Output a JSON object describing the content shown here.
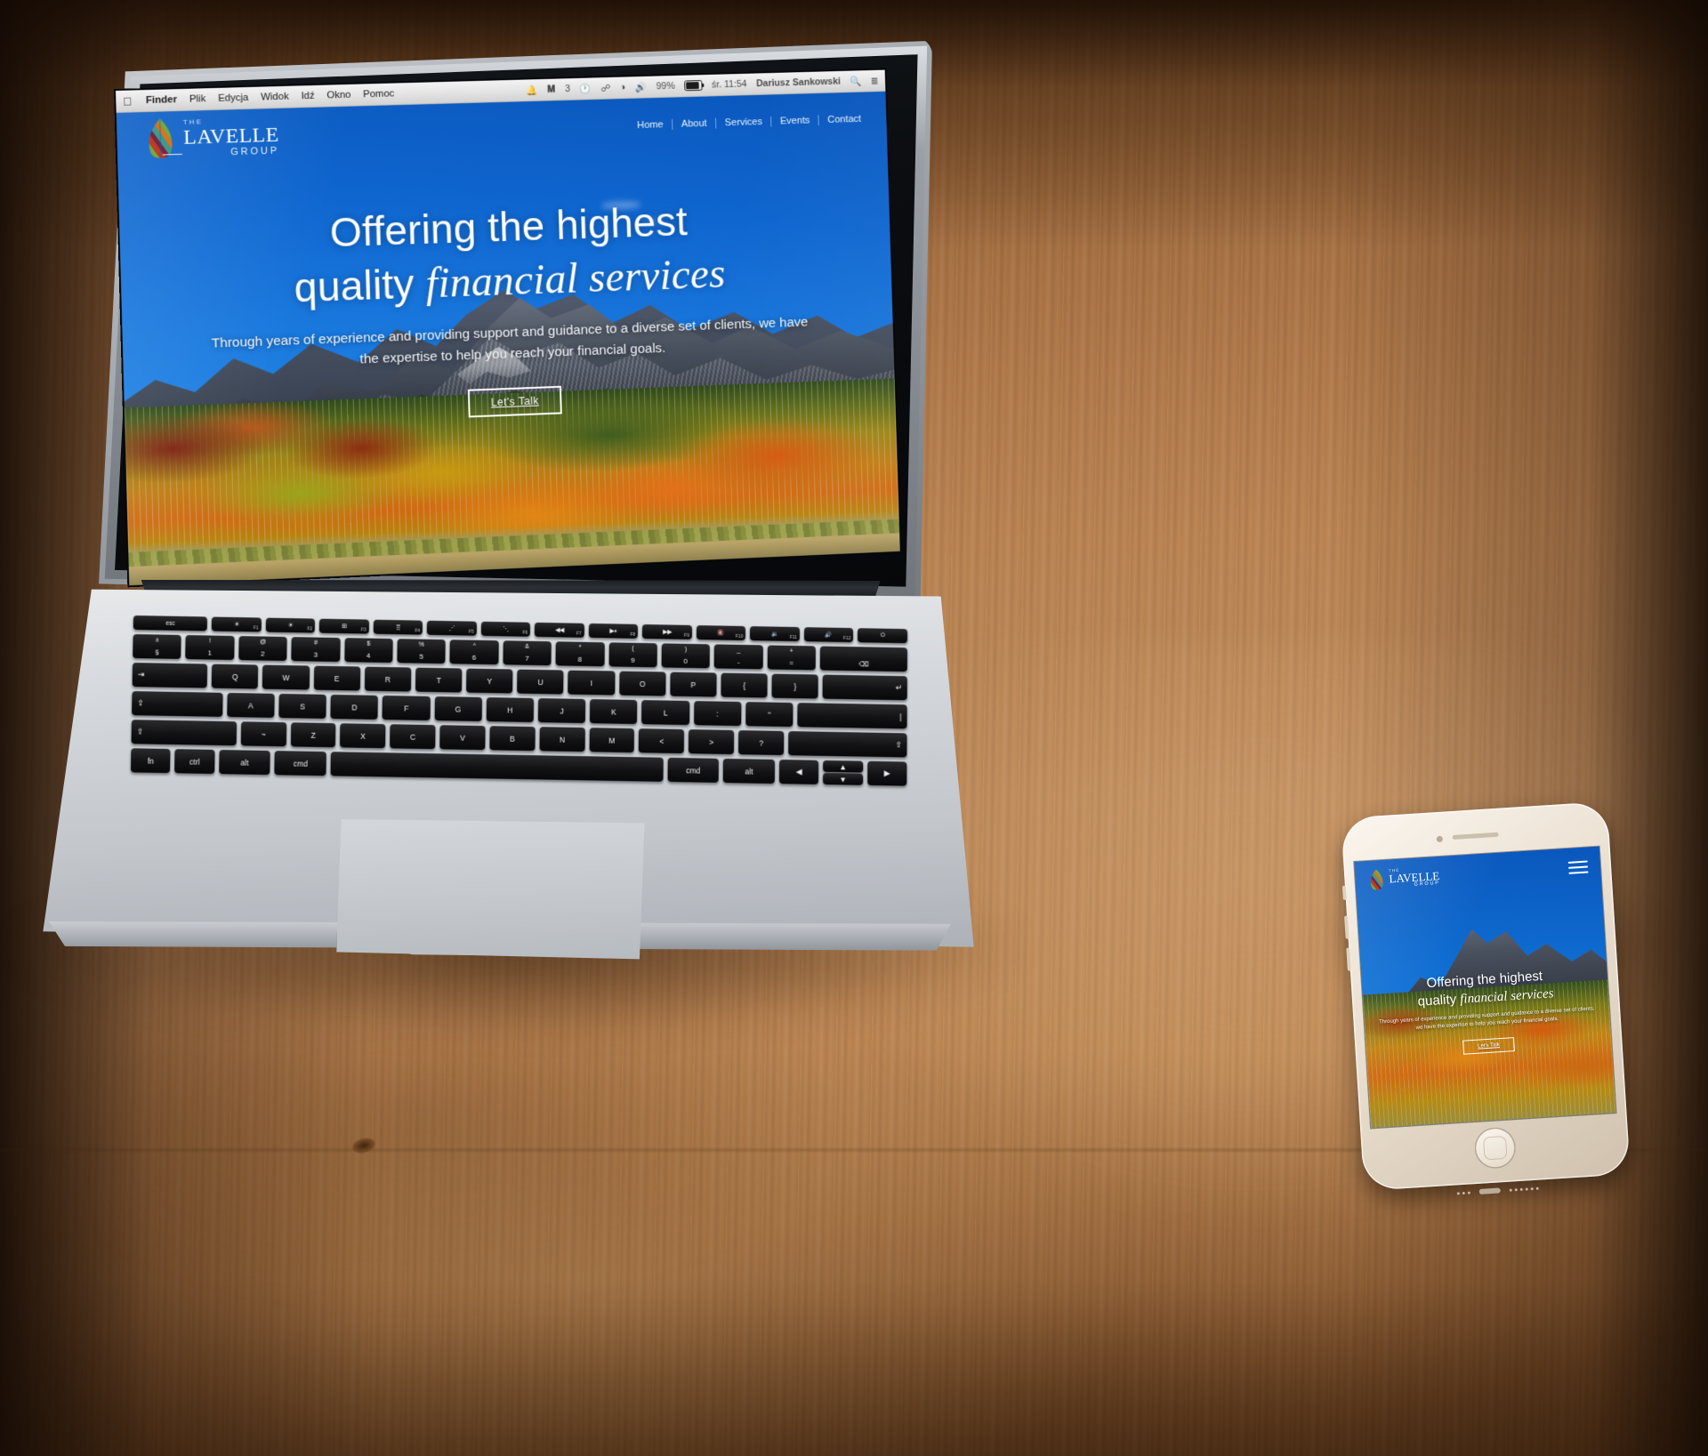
{
  "os": {
    "menubar": {
      "apple_icon": "apple-icon",
      "items": [
        {
          "label": "Finder",
          "bold": true
        },
        {
          "label": "Plik",
          "bold": false
        },
        {
          "label": "Edycja",
          "bold": false
        },
        {
          "label": "Widok",
          "bold": false
        },
        {
          "label": "Idź",
          "bold": false
        },
        {
          "label": "Okno",
          "bold": false
        },
        {
          "label": "Pomoc",
          "bold": false
        }
      ],
      "status": {
        "bell_icon": "bell-icon",
        "alfred_icon": "alfred-icon",
        "alfred_count": "3",
        "timemachine_icon": "time-machine-icon",
        "bluetooth_icon": "bluetooth-icon",
        "wifi_icon": "wifi-icon",
        "volume_icon": "volume-icon",
        "battery_percent": "99%",
        "battery_icon": "battery-charging-icon",
        "clock": "śr. 11:54",
        "user": "Dariusz Sankowski",
        "search_icon": "spotlight-search-icon",
        "notification_center_icon": "notification-center-icon"
      }
    }
  },
  "site": {
    "logo": {
      "icon": "leaf-logo-icon",
      "the": "THE",
      "name": "LAVELLE",
      "group": "GROUP"
    },
    "nav": [
      {
        "label": "Home"
      },
      {
        "label": "About"
      },
      {
        "label": "Services"
      },
      {
        "label": "Events"
      },
      {
        "label": "Contact"
      }
    ],
    "hero": {
      "line1": "Offering the highest",
      "line2_plain": "quality ",
      "line2_italic": "financial services",
      "subtitle": "Through years of experience and providing support and guidance to a diverse set of clients, we have the expertise to help you reach your financial goals.",
      "cta": "Let's Talk"
    },
    "colors": {
      "sky_blue": "#0f66cf",
      "accent_white": "#ffffff",
      "leaf_teal": "#3f9b8e",
      "leaf_green": "#7aa83f",
      "leaf_orange": "#e2701d",
      "leaf_red": "#c23b22",
      "leaf_maroon": "#7b2440"
    }
  },
  "phone": {
    "menu_icon": "hamburger-menu-icon",
    "home_button": "home-button",
    "lightning_port": "lightning-port-icon",
    "speaker_grille": "speaker-grille-icon"
  },
  "keyboard": {
    "fn_row": [
      {
        "label": "esc",
        "sub": ""
      },
      {
        "label": "☀",
        "sub": "F1"
      },
      {
        "label": "☀",
        "sub": "F2"
      },
      {
        "label": "⊞",
        "sub": "F3"
      },
      {
        "label": "⣿",
        "sub": "F4"
      },
      {
        "label": "⋰",
        "sub": "F5"
      },
      {
        "label": "⋱",
        "sub": "F6"
      },
      {
        "label": "◀◀",
        "sub": "F7"
      },
      {
        "label": "▶⏸",
        "sub": "F8"
      },
      {
        "label": "▶▶",
        "sub": "F9"
      },
      {
        "label": "🔇",
        "sub": "F10"
      },
      {
        "label": "🔉",
        "sub": "F11"
      },
      {
        "label": "🔊",
        "sub": "F12"
      },
      {
        "label": "⏻",
        "sub": ""
      }
    ],
    "row_num": [
      {
        "up": "±",
        "dn": "§"
      },
      {
        "up": "!",
        "dn": "1"
      },
      {
        "up": "@",
        "dn": "2"
      },
      {
        "up": "#",
        "dn": "3"
      },
      {
        "up": "$",
        "dn": "4"
      },
      {
        "up": "%",
        "dn": "5"
      },
      {
        "up": "^",
        "dn": "6"
      },
      {
        "up": "&",
        "dn": "7"
      },
      {
        "up": "*",
        "dn": "8"
      },
      {
        "up": "(",
        "dn": "9"
      },
      {
        "up": ")",
        "dn": "0"
      },
      {
        "up": "_",
        "dn": "-"
      },
      {
        "up": "+",
        "dn": "="
      },
      {
        "up": "",
        "dn": "⌫"
      }
    ],
    "row_q": [
      "⇥",
      "Q",
      "W",
      "E",
      "R",
      "T",
      "Y",
      "U",
      "I",
      "O",
      "P",
      "{",
      "}",
      "↵"
    ],
    "row_a": [
      "⇪",
      "A",
      "S",
      "D",
      "F",
      "G",
      "H",
      "J",
      "K",
      "L",
      ":",
      "\"",
      "|"
    ],
    "row_z": [
      "⇧",
      "~",
      "Z",
      "X",
      "C",
      "V",
      "B",
      "N",
      "M",
      "<",
      ">",
      "?",
      "⇧"
    ],
    "row_mod": [
      {
        "label": "fn"
      },
      {
        "label": "ctrl"
      },
      {
        "label": "alt"
      },
      {
        "label": "cmd"
      },
      {
        "label": ""
      },
      {
        "label": "cmd"
      },
      {
        "label": "alt"
      }
    ]
  }
}
